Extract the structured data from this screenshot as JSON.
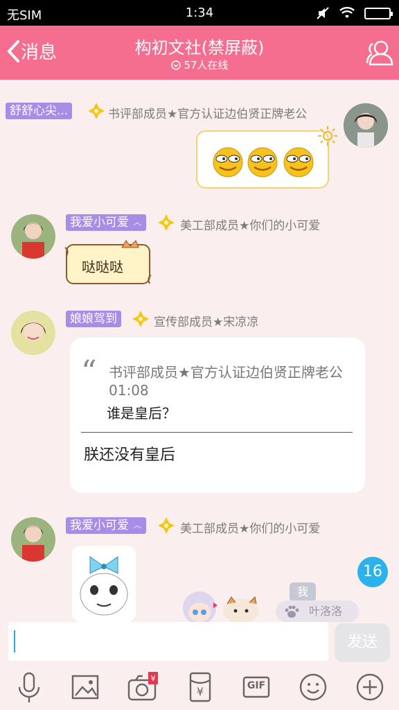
{
  "status_bar": {
    "carrier": "无SIM",
    "time": "1:34"
  },
  "nav": {
    "back_label": "消息",
    "title": "构初文社(禁屏蔽)",
    "online": "57人在线"
  },
  "messages": [
    {
      "tag": "舒舒心尖...",
      "title": "书评部成员★官方认证边伯贤正牌老公",
      "content": "[emoji sticker]"
    },
    {
      "tag": "我爱小可爱",
      "title": "美工部成员★你们的小可爱",
      "content": "哒哒哒"
    },
    {
      "tag": "娘娘驾到",
      "title": "宣传部成员★宋凉凉",
      "quote": {
        "meta": "书评部成员★官方认证边伯贤正牌老公 01:08",
        "text": "谁是皇后？"
      },
      "reply": "朕还没有皇后"
    },
    {
      "tag": "我爱小可爱",
      "title": "美工部成员★你们的小可爱",
      "content": "[image]"
    }
  ],
  "unread_badge": "16",
  "mention": {
    "small": "我",
    "pill": "叶洛洛"
  },
  "input": {
    "send_label": "发送"
  },
  "toolbar": {
    "gif_label": "GIF"
  },
  "colors": {
    "nav": "#f56d8f",
    "tag": "#a98ce6",
    "badge": "#2cb2ea"
  }
}
